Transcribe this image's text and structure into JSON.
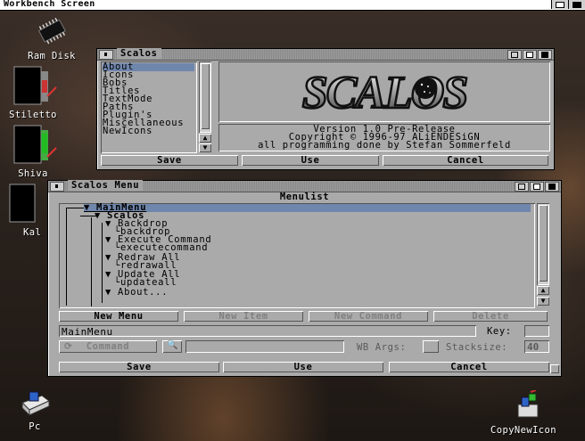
{
  "screen": {
    "title": "Workbench Screen"
  },
  "desktop_icons": [
    {
      "label": "Ram Disk",
      "icon": "chip-icon"
    },
    {
      "label": "Stiletto",
      "icon": "monitor-icon"
    },
    {
      "label": "Shiva",
      "icon": "monitor-icon"
    },
    {
      "label": "Kal",
      "icon": "monitor-icon"
    },
    {
      "label": "Pc",
      "icon": "pc-drive-icon"
    },
    {
      "label": "CopyNewIcon",
      "icon": "tool-icon"
    }
  ],
  "prefs_window": {
    "title": "Scalos",
    "categories": [
      "About",
      "Icons",
      "Bobs",
      "Titles",
      "TextMode",
      "Paths",
      "Plugin's",
      "Miscellaneous",
      "NewIcons"
    ],
    "selected": "About",
    "logo_text": "SCALOS",
    "info_lines": [
      "Version 1.0 Pre-Release",
      "Copyright © 1996-97 ALiENDESiGN",
      "all programming done by Stefan Sommerfeld"
    ],
    "buttons": {
      "save": "Save",
      "use": "Use",
      "cancel": "Cancel"
    }
  },
  "menu_window": {
    "title": "Scalos Menu",
    "list_header": "Menulist",
    "tree": [
      {
        "label": "MainMenu",
        "level": 0,
        "selected": true
      },
      {
        "label": "Scalos",
        "level": 1
      },
      {
        "label": "Backdrop",
        "level": 2
      },
      {
        "label": "backdrop",
        "level": 3
      },
      {
        "label": "Execute Command",
        "level": 2
      },
      {
        "label": "executecommand",
        "level": 3
      },
      {
        "label": "Redraw All",
        "level": 2
      },
      {
        "label": "redrawall",
        "level": 3
      },
      {
        "label": "Update All",
        "level": 2
      },
      {
        "label": "updateall",
        "level": 3
      },
      {
        "label": "About...",
        "level": 2
      }
    ],
    "action_buttons": {
      "new_menu": "New Menu",
      "new_item": "New Item",
      "new_command": "New Command",
      "delete": "Delete"
    },
    "name_value": "MainMenu",
    "key_label": "Key:",
    "key_value": "",
    "command_cycle": "Command",
    "command_value": "",
    "wb_args_label": "WB Args:",
    "stacksize_label": "Stacksize:",
    "stacksize_value": "40",
    "buttons": {
      "save": "Save",
      "use": "Use",
      "cancel": "Cancel"
    }
  }
}
